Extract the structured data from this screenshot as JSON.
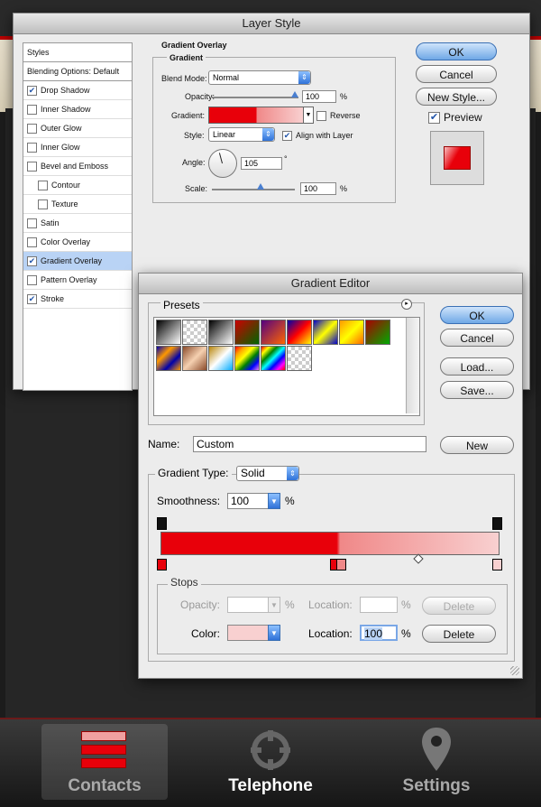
{
  "layer_style": {
    "title": "Layer Style",
    "styles_list": [
      {
        "label": "Styles",
        "checked": null,
        "selected": false,
        "header": true
      },
      {
        "label": "Blending Options: Default",
        "checked": null,
        "selected": false,
        "header": true
      },
      {
        "label": "Drop Shadow",
        "checked": true,
        "selected": false
      },
      {
        "label": "Inner Shadow",
        "checked": false,
        "selected": false
      },
      {
        "label": "Outer Glow",
        "checked": false,
        "selected": false
      },
      {
        "label": "Inner Glow",
        "checked": false,
        "selected": false
      },
      {
        "label": "Bevel and Emboss",
        "checked": false,
        "selected": false
      },
      {
        "label": "Contour",
        "checked": false,
        "selected": false,
        "indent": true
      },
      {
        "label": "Texture",
        "checked": false,
        "selected": false,
        "indent": true
      },
      {
        "label": "Satin",
        "checked": false,
        "selected": false
      },
      {
        "label": "Color Overlay",
        "checked": false,
        "selected": false
      },
      {
        "label": "Gradient Overlay",
        "checked": true,
        "selected": true
      },
      {
        "label": "Pattern Overlay",
        "checked": false,
        "selected": false
      },
      {
        "label": "Stroke",
        "checked": true,
        "selected": false
      }
    ],
    "section_title": "Gradient Overlay",
    "group_title": "Gradient",
    "blend_mode_label": "Blend Mode:",
    "blend_mode_value": "Normal",
    "opacity_label": "Opacity:",
    "opacity_value": "100",
    "percent": "%",
    "gradient_label": "Gradient:",
    "reverse_label": "Reverse",
    "style_label": "Style:",
    "style_value": "Linear",
    "align_label": "Align with Layer",
    "angle_label": "Angle:",
    "angle_value": "105",
    "degree": "°",
    "scale_label": "Scale:",
    "scale_value": "100",
    "ok": "OK",
    "cancel": "Cancel",
    "new_style": "New Style...",
    "preview": "Preview"
  },
  "gradient_editor": {
    "title": "Gradient Editor",
    "presets_label": "Presets",
    "ok": "OK",
    "cancel": "Cancel",
    "load": "Load...",
    "save": "Save...",
    "name_label": "Name:",
    "name_value": "Custom",
    "new_button": "New",
    "gradient_type_label": "Gradient Type:",
    "gradient_type_value": "Solid",
    "smoothness_label": "Smoothness:",
    "smoothness_value": "100",
    "percent": "%",
    "stops_label": "Stops",
    "opacity_label": "Opacity:",
    "location_label": "Location:",
    "color_label": "Color:",
    "color_location_value": "100",
    "delete": "Delete"
  },
  "tabbar": {
    "tabs": [
      "Contacts",
      "Telephone",
      "Settings"
    ]
  },
  "colors": {
    "accent_red": "#e8000a",
    "light_red": "#f8d0d0",
    "selection": "#b9d3f5"
  }
}
